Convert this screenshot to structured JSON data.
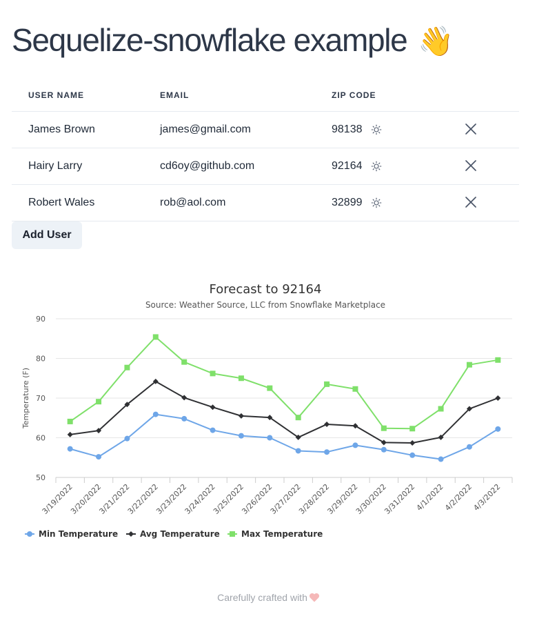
{
  "page": {
    "title": "Sequelize-snowflake example",
    "title_emoji": "👋"
  },
  "table": {
    "headers": {
      "name": "USER NAME",
      "email": "EMAIL",
      "zip": "ZIP CODE"
    },
    "rows": [
      {
        "name": "James Brown",
        "email": "james@gmail.com",
        "zip": "98138"
      },
      {
        "name": "Hairy Larry",
        "email": "cd6oy@github.com",
        "zip": "92164"
      },
      {
        "name": "Robert Wales",
        "email": "rob@aol.com",
        "zip": "32899"
      }
    ],
    "row_icons": {
      "weather": "sun-icon",
      "delete": "close-icon"
    }
  },
  "actions": {
    "add_user_label": "Add User"
  },
  "chart_data": {
    "type": "line",
    "title": "Forecast to 92164",
    "subtitle": "Source: Weather Source, LLC from Snowflake Marketplace",
    "xlabel": "",
    "ylabel": "Temperature (F)",
    "ylim": [
      50,
      90
    ],
    "yticks": [
      50,
      60,
      70,
      80,
      90
    ],
    "grid": true,
    "legend_position": "bottom-left",
    "categories": [
      "3/19/2022",
      "3/20/2022",
      "3/21/2022",
      "3/22/2022",
      "3/23/2022",
      "3/24/2022",
      "3/25/2022",
      "3/26/2022",
      "3/27/2022",
      "3/28/2022",
      "3/29/2022",
      "3/30/2022",
      "3/31/2022",
      "4/1/2022",
      "4/2/2022",
      "4/3/2022"
    ],
    "series": [
      {
        "name": "Min Temperature",
        "color": "#6ea6e8",
        "marker": "circle",
        "values": [
          57.2,
          55.2,
          59.8,
          65.9,
          64.8,
          61.9,
          60.5,
          60.0,
          56.7,
          56.4,
          58.1,
          57.0,
          55.6,
          54.6,
          57.7,
          62.2
        ]
      },
      {
        "name": "Avg Temperature",
        "color": "#2f3033",
        "marker": "diamond",
        "values": [
          60.8,
          61.8,
          68.4,
          74.2,
          70.1,
          67.7,
          65.5,
          65.1,
          60.1,
          63.4,
          63.0,
          58.8,
          58.7,
          60.1,
          67.3,
          70.0
        ]
      },
      {
        "name": "Max Temperature",
        "color": "#7fe06a",
        "marker": "square",
        "values": [
          64.1,
          69.1,
          77.7,
          85.4,
          79.1,
          76.2,
          75.0,
          72.5,
          65.1,
          73.5,
          72.3,
          62.4,
          62.3,
          67.3,
          78.4,
          79.6
        ]
      }
    ]
  },
  "footer": {
    "text": "Carefully crafted with"
  }
}
